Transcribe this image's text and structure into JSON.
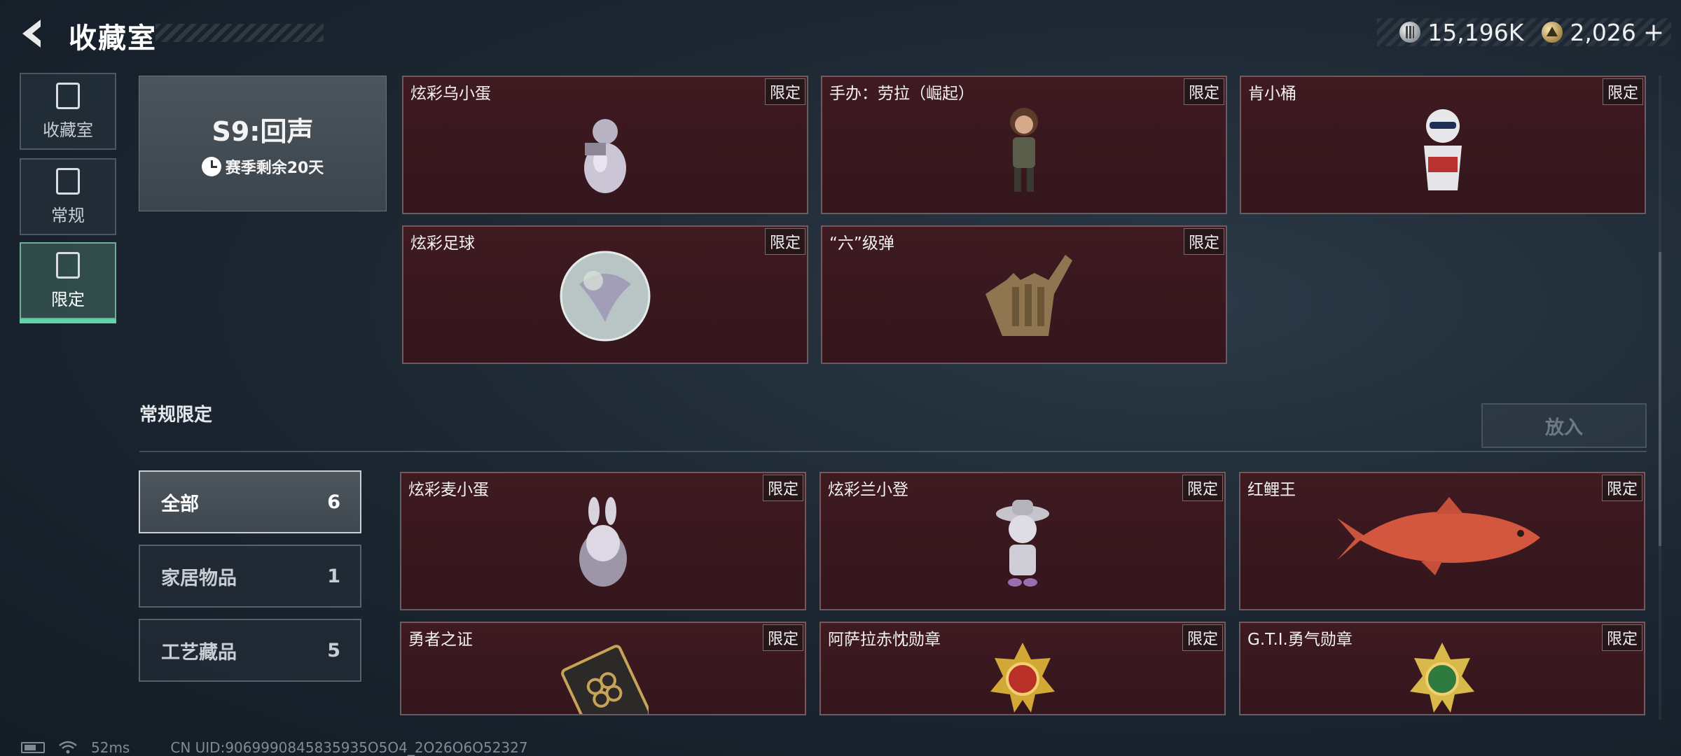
{
  "header": {
    "title": "收藏室",
    "currencies": [
      {
        "icon": "silver-coin-icon",
        "value": "15,196K"
      },
      {
        "icon": "gold-coin-icon",
        "value": "2,026"
      }
    ],
    "plus_label": "+"
  },
  "nav": {
    "tabs": [
      {
        "label": "收藏室",
        "icon": "collection-room-icon",
        "active": false
      },
      {
        "label": "常规",
        "icon": "regular-icon",
        "active": false
      },
      {
        "label": "限定",
        "icon": "limited-icon",
        "active": true
      }
    ]
  },
  "season": {
    "title": "S9:回声",
    "remaining": "赛季剩余20天"
  },
  "season_items": [
    {
      "name": "炫彩乌小蛋",
      "tag": "限定"
    },
    {
      "name": "手办：劳拉（崛起）",
      "tag": "限定"
    },
    {
      "name": "肯小桶",
      "tag": "限定"
    },
    {
      "name": "炫彩足球",
      "tag": "限定"
    },
    {
      "name": "“六”级弹",
      "tag": "限定"
    }
  ],
  "section": {
    "title": "常规限定",
    "put_in_label": "放入"
  },
  "categories": [
    {
      "label": "全部",
      "count": "6",
      "selected": true
    },
    {
      "label": "家居物品",
      "count": "1",
      "selected": false
    },
    {
      "label": "工艺藏品",
      "count": "5",
      "selected": false
    }
  ],
  "regular_items": [
    {
      "name": "炫彩麦小蛋",
      "tag": "限定"
    },
    {
      "name": "炫彩兰小登",
      "tag": "限定"
    },
    {
      "name": "红鲤王",
      "tag": "限定"
    },
    {
      "name": "勇者之证",
      "tag": "限定"
    },
    {
      "name": "阿萨拉赤忱勋章",
      "tag": "限定"
    },
    {
      "name": "G.T.I.勇气勋章",
      "tag": "限定"
    }
  ],
  "status": {
    "ping": "52ms",
    "uid": "CN UID:9069990845835935O5O4_2O26O6O52327"
  },
  "colors": {
    "accent": "#5fd6a6",
    "card_bg": "#3f1a21",
    "selected_category": "#4e565e"
  }
}
